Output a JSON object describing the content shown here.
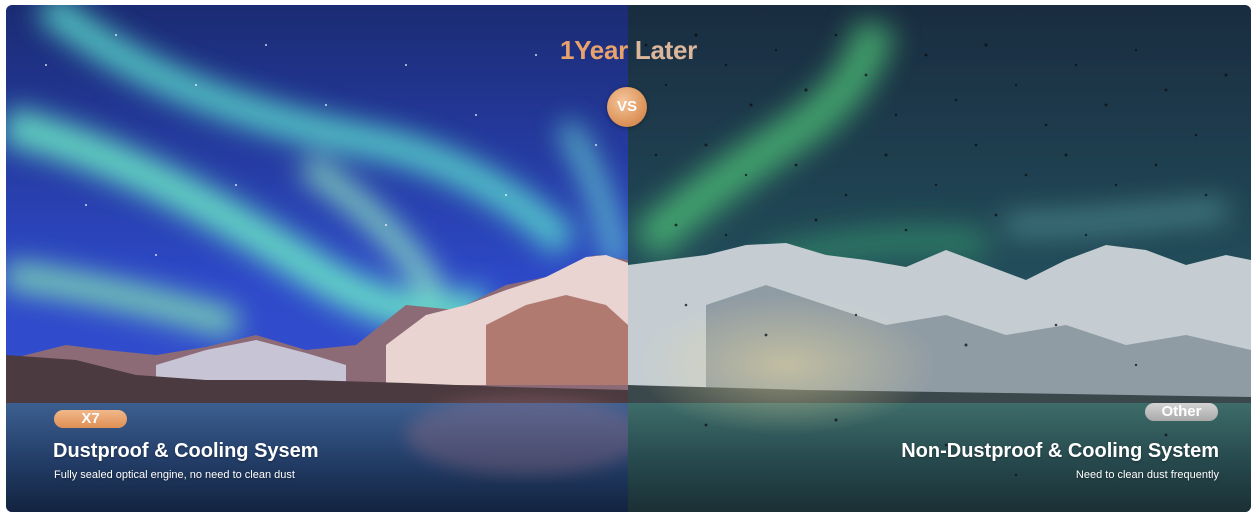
{
  "banner": {
    "title_accent": "1Year",
    "title_rest": " Later",
    "vs_label": "VS",
    "left": {
      "badge": "X7",
      "heading": "Dustproof & Cooling Sysem",
      "subtext": "Fully sealed optical engine, no need to clean dust"
    },
    "right": {
      "badge": "Other",
      "heading": "Non-Dustproof & Cooling System",
      "subtext": "Need to clean dust frequently"
    }
  },
  "colors": {
    "accent": "#e9a26c",
    "badge_left": "#e6955a",
    "badge_right": "#b5b5b5"
  }
}
